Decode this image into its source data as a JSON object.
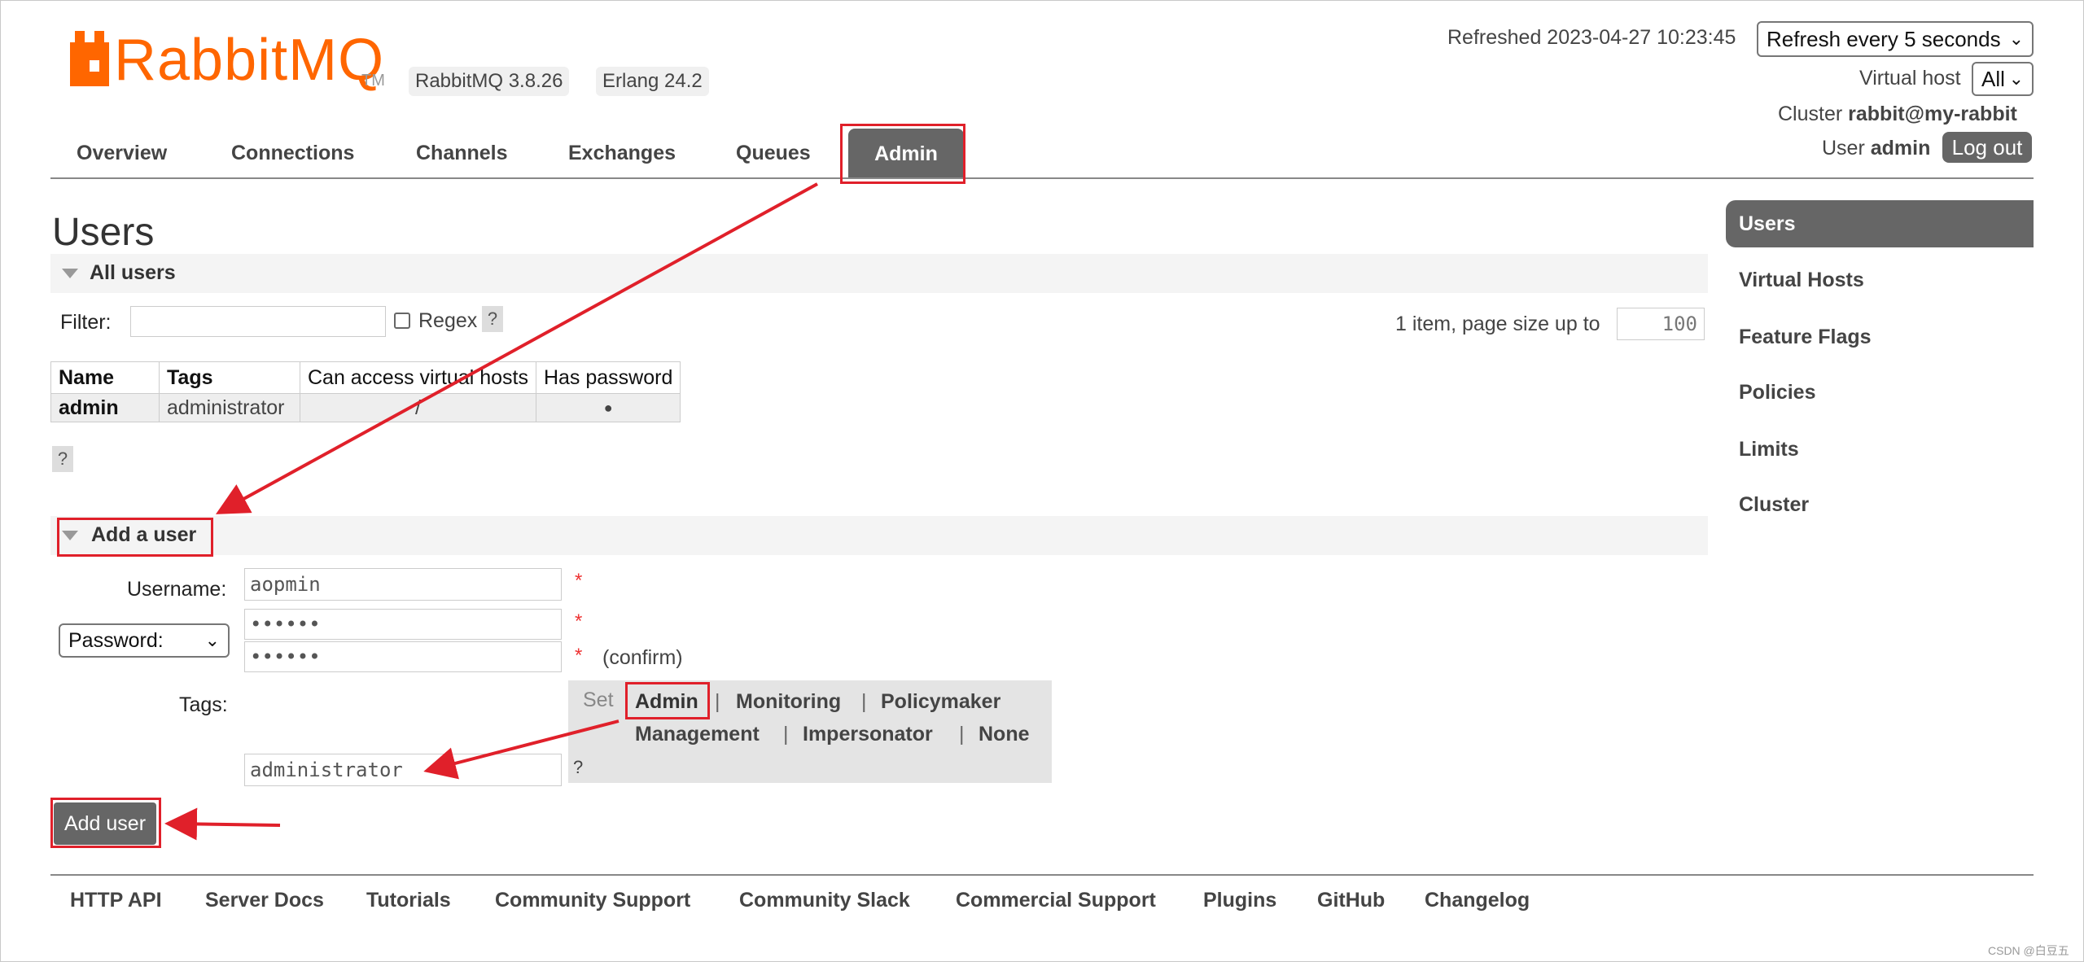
{
  "brand": {
    "logo_text": "RabbitMQ",
    "tm": "TM",
    "version_badge": "RabbitMQ 3.8.26",
    "erlang_badge": "Erlang 24.2",
    "accent": "#ff6600"
  },
  "header": {
    "refreshed": "Refreshed 2023-04-27 10:23:45",
    "refresh_select": "Refresh every 5 seconds",
    "vhost_label": "Virtual host",
    "vhost_select": "All",
    "cluster_label": "Cluster",
    "cluster_value": "rabbit@my-rabbit",
    "user_label": "User",
    "user_value": "admin",
    "logout": "Log out"
  },
  "nav": {
    "items": [
      "Overview",
      "Connections",
      "Channels",
      "Exchanges",
      "Queues"
    ],
    "active": "Admin"
  },
  "page": {
    "title": "Users"
  },
  "all_users": {
    "header": "All users",
    "filter_label": "Filter:",
    "filter_value": "",
    "regex_label": "Regex",
    "help": "?",
    "paging_text": "1 item, page size up to",
    "page_size": "100",
    "columns": [
      "Name",
      "Tags",
      "Can access virtual hosts",
      "Has password"
    ],
    "rows": [
      {
        "name": "admin",
        "tags": "administrator",
        "vhosts": "/",
        "has_password": "●"
      }
    ]
  },
  "add_user": {
    "header": "Add a user",
    "username_label": "Username:",
    "username_value": "aopmin",
    "password_select": "Password:",
    "password_value": "••••••",
    "confirm_value": "••••••",
    "confirm_label": "(confirm)",
    "required_mark": "*",
    "tags_label": "Tags:",
    "set_label": "Set",
    "tag_options": [
      "Admin",
      "Monitoring",
      "Policymaker",
      "Management",
      "Impersonator",
      "None"
    ],
    "tag_separator": "|",
    "tags_value": "administrator",
    "submit": "Add user"
  },
  "sidebar": {
    "active": "Users",
    "items": [
      "Virtual Hosts",
      "Feature Flags",
      "Policies",
      "Limits",
      "Cluster"
    ]
  },
  "footer": {
    "links": [
      "HTTP API",
      "Server Docs",
      "Tutorials",
      "Community Support",
      "Community Slack",
      "Commercial Support",
      "Plugins",
      "GitHub",
      "Changelog"
    ]
  },
  "watermark": "CSDN @白豆五",
  "annotation_color": "#e0202a"
}
